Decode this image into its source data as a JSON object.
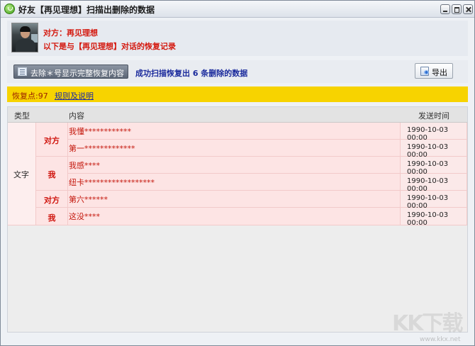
{
  "window": {
    "title": "好友【再见理想】扫描出删除的数据"
  },
  "header": {
    "contact_line": "对方：再见理想",
    "description": "以下是与【再见理想】对话的恢复记录"
  },
  "toolbar": {
    "remove_button_label": "去除＊号显示完整恢复内容",
    "scan_status": "成功扫描恢复出 6 条删除的数据",
    "export_button_label": "导出"
  },
  "notice": {
    "recovery_points": "恢复点:97",
    "rules_link": "规则及说明"
  },
  "table": {
    "columns": [
      "类型",
      "内容",
      "发送时间"
    ],
    "type_value": "文字",
    "groups": [
      {
        "sender": "对方",
        "rows": [
          {
            "content": "我懂************",
            "time": "1990-10-03 00:00"
          },
          {
            "content": "第一*************",
            "time": "1990-10-03 00:00"
          }
        ]
      },
      {
        "sender": "我",
        "rows": [
          {
            "content": "我感****",
            "time": "1990-10-03 00:00"
          },
          {
            "content": "纽卡******************",
            "time": "1990-10-03 00:00"
          }
        ]
      },
      {
        "sender": "对方",
        "rows": [
          {
            "content": "第六******",
            "time": "1990-10-03 00:00"
          }
        ]
      },
      {
        "sender": "我",
        "rows": [
          {
            "content": "这没****",
            "time": "1990-10-03 00:00"
          }
        ]
      }
    ]
  },
  "watermark": {
    "text": "KK下载",
    "url": "www.kkx.net"
  }
}
